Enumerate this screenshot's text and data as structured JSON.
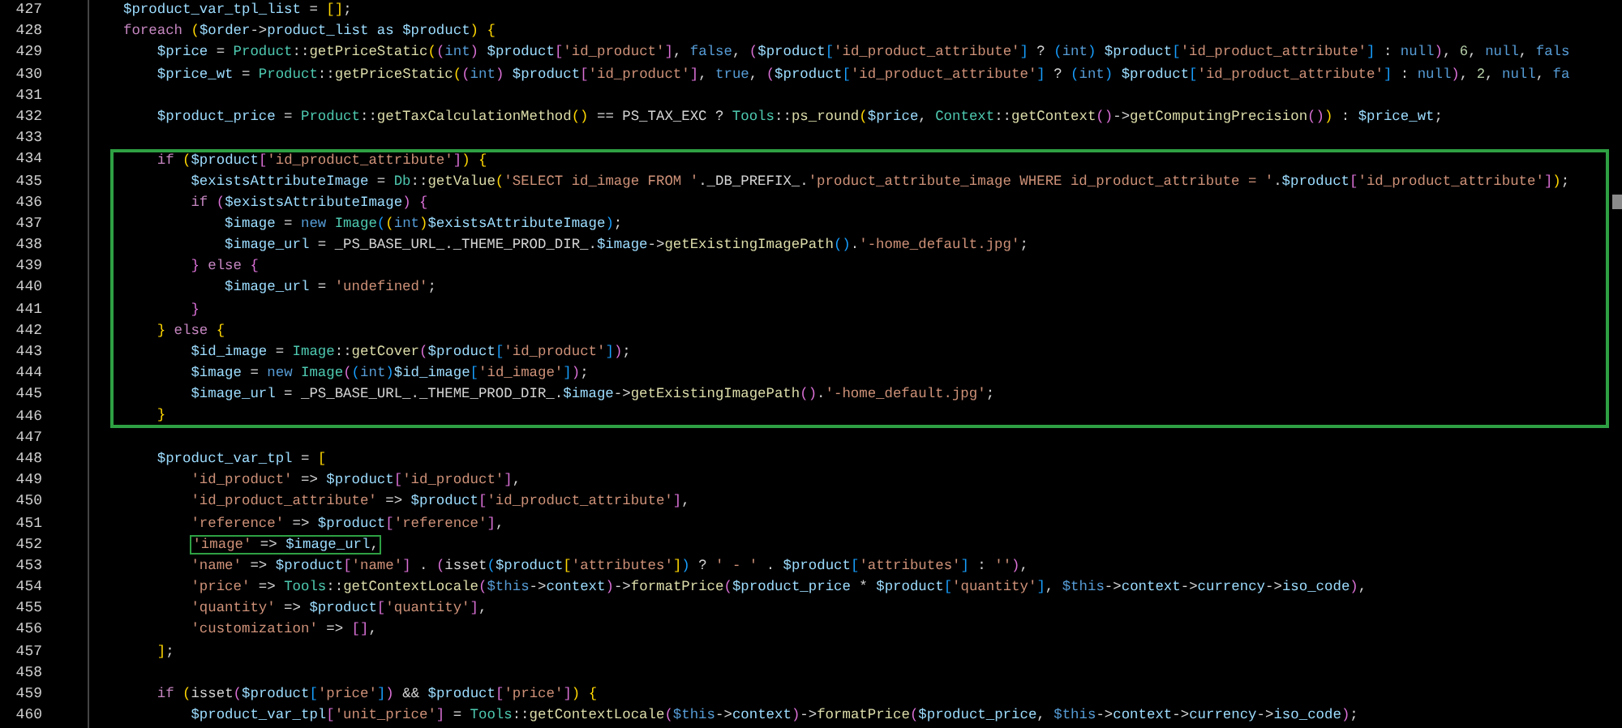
{
  "lines": [
    {
      "number": "427",
      "outlined": false,
      "tokens": [
        {
          "text": "$product_var_tpl_list",
          "kind": "var"
        },
        {
          "text": " = ",
          "kind": "op"
        },
        {
          "text": "[]",
          "kind": "b1"
        },
        {
          "text": ";",
          "kind": "op"
        }
      ]
    },
    {
      "number": "428",
      "outlined": false,
      "tokens": [
        {
          "text": "foreach ",
          "kind": "kw"
        },
        {
          "text": "(",
          "kind": "b1"
        },
        {
          "text": "$order",
          "kind": "var"
        },
        {
          "text": "->",
          "kind": "op"
        },
        {
          "text": "product_list as ",
          "kind": "var"
        },
        {
          "text": "$product",
          "kind": "var"
        },
        {
          "text": ")",
          "kind": "b1"
        },
        {
          "text": " {",
          "kind": "b1"
        }
      ]
    },
    {
      "number": "429",
      "outlined": false,
      "tokens": [
        {
          "text": "    $price",
          "kind": "var"
        },
        {
          "text": " = ",
          "kind": "op"
        },
        {
          "text": "Product",
          "kind": "cls"
        },
        {
          "text": "::",
          "kind": "op"
        },
        {
          "text": "getPriceStatic",
          "kind": "fn"
        },
        {
          "text": "(",
          "kind": "b1"
        },
        {
          "text": "(",
          "kind": "b2"
        },
        {
          "text": "int",
          "kind": "key"
        },
        {
          "text": ")",
          "kind": "b2"
        },
        {
          "text": " $product",
          "kind": "var"
        },
        {
          "text": "[",
          "kind": "b2"
        },
        {
          "text": "'id_product'",
          "kind": "str"
        },
        {
          "text": "]",
          "kind": "b2"
        },
        {
          "text": ", ",
          "kind": "op"
        },
        {
          "text": "false",
          "kind": "key"
        },
        {
          "text": ", ",
          "kind": "op"
        },
        {
          "text": "(",
          "kind": "b2"
        },
        {
          "text": "$product",
          "kind": "var"
        },
        {
          "text": "[",
          "kind": "b3"
        },
        {
          "text": "'id_product_attribute'",
          "kind": "str"
        },
        {
          "text": "]",
          "kind": "b3"
        },
        {
          "text": " ? ",
          "kind": "op"
        },
        {
          "text": "(",
          "kind": "b3"
        },
        {
          "text": "int",
          "kind": "key"
        },
        {
          "text": ")",
          "kind": "b3"
        },
        {
          "text": " $product",
          "kind": "var"
        },
        {
          "text": "[",
          "kind": "b3"
        },
        {
          "text": "'id_product_attribute'",
          "kind": "str"
        },
        {
          "text": "]",
          "kind": "b3"
        },
        {
          "text": " : ",
          "kind": "op"
        },
        {
          "text": "null",
          "kind": "key"
        },
        {
          "text": ")",
          "kind": "b2"
        },
        {
          "text": ", ",
          "kind": "op"
        },
        {
          "text": "6",
          "kind": "num"
        },
        {
          "text": ", ",
          "kind": "op"
        },
        {
          "text": "null",
          "kind": "key"
        },
        {
          "text": ", ",
          "kind": "op"
        },
        {
          "text": "fals",
          "kind": "key"
        }
      ]
    },
    {
      "number": "430",
      "outlined": false,
      "tokens": [
        {
          "text": "    $price_wt",
          "kind": "var"
        },
        {
          "text": " = ",
          "kind": "op"
        },
        {
          "text": "Product",
          "kind": "cls"
        },
        {
          "text": "::",
          "kind": "op"
        },
        {
          "text": "getPriceStatic",
          "kind": "fn"
        },
        {
          "text": "(",
          "kind": "b1"
        },
        {
          "text": "(",
          "kind": "b2"
        },
        {
          "text": "int",
          "kind": "key"
        },
        {
          "text": ")",
          "kind": "b2"
        },
        {
          "text": " $product",
          "kind": "var"
        },
        {
          "text": "[",
          "kind": "b2"
        },
        {
          "text": "'id_product'",
          "kind": "str"
        },
        {
          "text": "]",
          "kind": "b2"
        },
        {
          "text": ", ",
          "kind": "op"
        },
        {
          "text": "true",
          "kind": "key"
        },
        {
          "text": ", ",
          "kind": "op"
        },
        {
          "text": "(",
          "kind": "b2"
        },
        {
          "text": "$product",
          "kind": "var"
        },
        {
          "text": "[",
          "kind": "b3"
        },
        {
          "text": "'id_product_attribute'",
          "kind": "str"
        },
        {
          "text": "]",
          "kind": "b3"
        },
        {
          "text": " ? ",
          "kind": "op"
        },
        {
          "text": "(",
          "kind": "b3"
        },
        {
          "text": "int",
          "kind": "key"
        },
        {
          "text": ")",
          "kind": "b3"
        },
        {
          "text": " $product",
          "kind": "var"
        },
        {
          "text": "[",
          "kind": "b3"
        },
        {
          "text": "'id_product_attribute'",
          "kind": "str"
        },
        {
          "text": "]",
          "kind": "b3"
        },
        {
          "text": " : ",
          "kind": "op"
        },
        {
          "text": "null",
          "kind": "key"
        },
        {
          "text": ")",
          "kind": "b2"
        },
        {
          "text": ", ",
          "kind": "op"
        },
        {
          "text": "2",
          "kind": "num"
        },
        {
          "text": ", ",
          "kind": "op"
        },
        {
          "text": "null",
          "kind": "key"
        },
        {
          "text": ", ",
          "kind": "op"
        },
        {
          "text": "fa",
          "kind": "key"
        }
      ]
    },
    {
      "number": "431",
      "outlined": false
    },
    {
      "number": "432",
      "outlined": false,
      "tokens": [
        {
          "text": "    $product_price",
          "kind": "var"
        },
        {
          "text": " = ",
          "kind": "op"
        },
        {
          "text": "Product",
          "kind": "cls"
        },
        {
          "text": "::",
          "kind": "op"
        },
        {
          "text": "getTaxCalculationMethod",
          "kind": "fn"
        },
        {
          "text": "()",
          "kind": "b1"
        },
        {
          "text": " == PS_TAX_EXC ? ",
          "kind": "op"
        },
        {
          "text": "Tools",
          "kind": "cls"
        },
        {
          "text": "::",
          "kind": "op"
        },
        {
          "text": "ps_round",
          "kind": "fn"
        },
        {
          "text": "(",
          "kind": "b1"
        },
        {
          "text": "$price",
          "kind": "var"
        },
        {
          "text": ", ",
          "kind": "op"
        },
        {
          "text": "Context",
          "kind": "cls"
        },
        {
          "text": "::",
          "kind": "op"
        },
        {
          "text": "getContext",
          "kind": "fn"
        },
        {
          "text": "()",
          "kind": "b2"
        },
        {
          "text": "->",
          "kind": "op"
        },
        {
          "text": "getComputingPrecision",
          "kind": "fn"
        },
        {
          "text": "()",
          "kind": "b2"
        },
        {
          "text": ")",
          "kind": "b1"
        },
        {
          "text": " : ",
          "kind": "op"
        },
        {
          "text": "$price_wt",
          "kind": "var"
        },
        {
          "text": ";",
          "kind": "op"
        }
      ]
    },
    {
      "number": "433",
      "outlined": false
    },
    {
      "number": "434",
      "outlined": true,
      "tokens": [
        {
          "text": "    if ",
          "kind": "kw"
        },
        {
          "text": "(",
          "kind": "b1"
        },
        {
          "text": "$product",
          "kind": "var"
        },
        {
          "text": "[",
          "kind": "b2"
        },
        {
          "text": "'id_product_attribute'",
          "kind": "str"
        },
        {
          "text": "]",
          "kind": "b2"
        },
        {
          "text": ")",
          "kind": "b1"
        },
        {
          "text": " {",
          "kind": "b1"
        }
      ]
    },
    {
      "number": "435",
      "outlined": true,
      "tokens": [
        {
          "text": "        $existsAttributeImage",
          "kind": "var"
        },
        {
          "text": " = ",
          "kind": "op"
        },
        {
          "text": "Db",
          "kind": "cls"
        },
        {
          "text": "::",
          "kind": "op"
        },
        {
          "text": "getValue",
          "kind": "fn"
        },
        {
          "text": "(",
          "kind": "b1"
        },
        {
          "text": "'SELECT id_image FROM '",
          "kind": "str"
        },
        {
          "text": "._DB_PREFIX_.",
          "kind": "op"
        },
        {
          "text": "'product_attribute_image WHERE id_product_attribute = '",
          "kind": "str"
        },
        {
          "text": ".",
          "kind": "op"
        },
        {
          "text": "$product",
          "kind": "var"
        },
        {
          "text": "[",
          "kind": "b2"
        },
        {
          "text": "'id_product_attribute'",
          "kind": "str"
        },
        {
          "text": "]",
          "kind": "b2"
        },
        {
          "text": ")",
          "kind": "b1"
        },
        {
          "text": ";",
          "kind": "op"
        }
      ]
    },
    {
      "number": "436",
      "outlined": true,
      "tokens": [
        {
          "text": "        if ",
          "kind": "kw"
        },
        {
          "text": "(",
          "kind": "b2"
        },
        {
          "text": "$existsAttributeImage",
          "kind": "var"
        },
        {
          "text": ")",
          "kind": "b2"
        },
        {
          "text": " {",
          "kind": "b2"
        }
      ]
    },
    {
      "number": "437",
      "outlined": true,
      "tokens": [
        {
          "text": "            $image",
          "kind": "var"
        },
        {
          "text": " = ",
          "kind": "op"
        },
        {
          "text": "new ",
          "kind": "key"
        },
        {
          "text": "Image",
          "kind": "cls"
        },
        {
          "text": "(",
          "kind": "b3"
        },
        {
          "text": "(",
          "kind": "b1"
        },
        {
          "text": "int",
          "kind": "key"
        },
        {
          "text": ")",
          "kind": "b1"
        },
        {
          "text": "$existsAttributeImage",
          "kind": "var"
        },
        {
          "text": ")",
          "kind": "b3"
        },
        {
          "text": ";",
          "kind": "op"
        }
      ]
    },
    {
      "number": "438",
      "outlined": true,
      "tokens": [
        {
          "text": "            $image_url",
          "kind": "var"
        },
        {
          "text": " = _PS_BASE_URL_._THEME_PROD_DIR_.",
          "kind": "op"
        },
        {
          "text": "$image",
          "kind": "var"
        },
        {
          "text": "->",
          "kind": "op"
        },
        {
          "text": "getExistingImagePath",
          "kind": "fn"
        },
        {
          "text": "()",
          "kind": "b3"
        },
        {
          "text": ".",
          "kind": "op"
        },
        {
          "text": "'-home_default.jpg'",
          "kind": "str"
        },
        {
          "text": ";",
          "kind": "op"
        }
      ]
    },
    {
      "number": "439",
      "outlined": true,
      "tokens": [
        {
          "text": "        }",
          "kind": "b2"
        },
        {
          "text": " else",
          "kind": "kw"
        },
        {
          "text": " {",
          "kind": "b2"
        }
      ]
    },
    {
      "number": "440",
      "outlined": true,
      "tokens": [
        {
          "text": "            $image_url",
          "kind": "var"
        },
        {
          "text": " = ",
          "kind": "op"
        },
        {
          "text": "'undefined'",
          "kind": "str"
        },
        {
          "text": ";",
          "kind": "op"
        }
      ]
    },
    {
      "number": "441",
      "outlined": true,
      "tokens": [
        {
          "text": "        }",
          "kind": "b2"
        }
      ]
    },
    {
      "number": "442",
      "outlined": true,
      "tokens": [
        {
          "text": "    }",
          "kind": "b1"
        },
        {
          "text": " else",
          "kind": "kw"
        },
        {
          "text": " {",
          "kind": "b1"
        }
      ]
    },
    {
      "number": "443",
      "outlined": true,
      "tokens": [
        {
          "text": "        $id_image",
          "kind": "var"
        },
        {
          "text": " = ",
          "kind": "op"
        },
        {
          "text": "Image",
          "kind": "cls"
        },
        {
          "text": "::",
          "kind": "op"
        },
        {
          "text": "getCover",
          "kind": "fn"
        },
        {
          "text": "(",
          "kind": "b2"
        },
        {
          "text": "$product",
          "kind": "var"
        },
        {
          "text": "[",
          "kind": "b3"
        },
        {
          "text": "'id_product'",
          "kind": "str"
        },
        {
          "text": "]",
          "kind": "b3"
        },
        {
          "text": ")",
          "kind": "b2"
        },
        {
          "text": ";",
          "kind": "op"
        }
      ]
    },
    {
      "number": "444",
      "outlined": true,
      "tokens": [
        {
          "text": "        $image",
          "kind": "var"
        },
        {
          "text": " = ",
          "kind": "op"
        },
        {
          "text": "new ",
          "kind": "key"
        },
        {
          "text": "Image",
          "kind": "cls"
        },
        {
          "text": "(",
          "kind": "b2"
        },
        {
          "text": "(",
          "kind": "b3"
        },
        {
          "text": "int",
          "kind": "key"
        },
        {
          "text": ")",
          "kind": "b3"
        },
        {
          "text": "$id_image",
          "kind": "var"
        },
        {
          "text": "[",
          "kind": "b3"
        },
        {
          "text": "'id_image'",
          "kind": "str"
        },
        {
          "text": "]",
          "kind": "b3"
        },
        {
          "text": ")",
          "kind": "b2"
        },
        {
          "text": ";",
          "kind": "op"
        }
      ]
    },
    {
      "number": "445",
      "outlined": true,
      "tokens": [
        {
          "text": "        $image_url",
          "kind": "var"
        },
        {
          "text": " = _PS_BASE_URL_._THEME_PROD_DIR_.",
          "kind": "op"
        },
        {
          "text": "$image",
          "kind": "var"
        },
        {
          "text": "->",
          "kind": "op"
        },
        {
          "text": "getExistingImagePath",
          "kind": "fn"
        },
        {
          "text": "()",
          "kind": "b2"
        },
        {
          "text": ".",
          "kind": "op"
        },
        {
          "text": "'-home_default.jpg'",
          "kind": "str"
        },
        {
          "text": ";",
          "kind": "op"
        }
      ]
    },
    {
      "number": "446",
      "outlined": true,
      "tokens": [
        {
          "text": "    }",
          "kind": "b1"
        }
      ]
    },
    {
      "number": "447",
      "outlined": false
    },
    {
      "number": "448",
      "outlined": false,
      "tokens": [
        {
          "text": "    $product_var_tpl",
          "kind": "var"
        },
        {
          "text": " = ",
          "kind": "op"
        },
        {
          "text": "[",
          "kind": "b1"
        }
      ]
    },
    {
      "number": "449",
      "outlined": false,
      "tokens": [
        {
          "text": "        'id_product'",
          "kind": "str"
        },
        {
          "text": " => ",
          "kind": "op"
        },
        {
          "text": "$product",
          "kind": "var"
        },
        {
          "text": "[",
          "kind": "b2"
        },
        {
          "text": "'id_product'",
          "kind": "str"
        },
        {
          "text": "]",
          "kind": "b2"
        },
        {
          "text": ",",
          "kind": "op"
        }
      ]
    },
    {
      "number": "450",
      "outlined": false,
      "tokens": [
        {
          "text": "        'id_product_attribute'",
          "kind": "str"
        },
        {
          "text": " => ",
          "kind": "op"
        },
        {
          "text": "$product",
          "kind": "var"
        },
        {
          "text": "[",
          "kind": "b2"
        },
        {
          "text": "'id_product_attribute'",
          "kind": "str"
        },
        {
          "text": "]",
          "kind": "b2"
        },
        {
          "text": ",",
          "kind": "op"
        }
      ]
    },
    {
      "number": "451",
      "outlined": false,
      "tokens": [
        {
          "text": "        'reference'",
          "kind": "str"
        },
        {
          "text": " => ",
          "kind": "op"
        },
        {
          "text": "$product",
          "kind": "var"
        },
        {
          "text": "[",
          "kind": "b2"
        },
        {
          "text": "'reference'",
          "kind": "str"
        },
        {
          "text": "]",
          "kind": "b2"
        },
        {
          "text": ",",
          "kind": "op"
        }
      ]
    },
    {
      "number": "452",
      "outlined": true,
      "tokens": [
        {
          "text": "        'image'",
          "kind": "str"
        },
        {
          "text": " => ",
          "kind": "op"
        },
        {
          "text": "$image_url",
          "kind": "var"
        },
        {
          "text": ",",
          "kind": "op"
        }
      ]
    },
    {
      "number": "453",
      "outlined": false,
      "tokens": [
        {
          "text": "        'name'",
          "kind": "str"
        },
        {
          "text": " => ",
          "kind": "op"
        },
        {
          "text": "$product",
          "kind": "var"
        },
        {
          "text": "[",
          "kind": "b2"
        },
        {
          "text": "'name'",
          "kind": "str"
        },
        {
          "text": "]",
          "kind": "b2"
        },
        {
          "text": " . ",
          "kind": "op"
        },
        {
          "text": "(",
          "kind": "b2"
        },
        {
          "text": "isset",
          "kind": "op"
        },
        {
          "text": "(",
          "kind": "b3"
        },
        {
          "text": "$product",
          "kind": "var"
        },
        {
          "text": "[",
          "kind": "b1"
        },
        {
          "text": "'attributes'",
          "kind": "str"
        },
        {
          "text": "]",
          "kind": "b1"
        },
        {
          "text": ")",
          "kind": "b3"
        },
        {
          "text": " ? ",
          "kind": "op"
        },
        {
          "text": "' - '",
          "kind": "str"
        },
        {
          "text": " . ",
          "kind": "op"
        },
        {
          "text": "$product",
          "kind": "var"
        },
        {
          "text": "[",
          "kind": "b3"
        },
        {
          "text": "'attributes'",
          "kind": "str"
        },
        {
          "text": "]",
          "kind": "b3"
        },
        {
          "text": " : ",
          "kind": "op"
        },
        {
          "text": "''",
          "kind": "str"
        },
        {
          "text": ")",
          "kind": "b2"
        },
        {
          "text": ",",
          "kind": "op"
        }
      ]
    },
    {
      "number": "454",
      "outlined": false,
      "tokens": [
        {
          "text": "        'price'",
          "kind": "str"
        },
        {
          "text": " => ",
          "kind": "op"
        },
        {
          "text": "Tools",
          "kind": "cls"
        },
        {
          "text": "::",
          "kind": "op"
        },
        {
          "text": "getContextLocale",
          "kind": "fn"
        },
        {
          "text": "(",
          "kind": "b2"
        },
        {
          "text": "$this",
          "kind": "key"
        },
        {
          "text": "->",
          "kind": "op"
        },
        {
          "text": "context",
          "kind": "var"
        },
        {
          "text": ")",
          "kind": "b2"
        },
        {
          "text": "->",
          "kind": "op"
        },
        {
          "text": "formatPrice",
          "kind": "fn"
        },
        {
          "text": "(",
          "kind": "b2"
        },
        {
          "text": "$product_price",
          "kind": "var"
        },
        {
          "text": " * ",
          "kind": "op"
        },
        {
          "text": "$product",
          "kind": "var"
        },
        {
          "text": "[",
          "kind": "b3"
        },
        {
          "text": "'quantity'",
          "kind": "str"
        },
        {
          "text": "]",
          "kind": "b3"
        },
        {
          "text": ", ",
          "kind": "op"
        },
        {
          "text": "$this",
          "kind": "key"
        },
        {
          "text": "->",
          "kind": "op"
        },
        {
          "text": "context",
          "kind": "var"
        },
        {
          "text": "->",
          "kind": "op"
        },
        {
          "text": "currency",
          "kind": "var"
        },
        {
          "text": "->",
          "kind": "op"
        },
        {
          "text": "iso_code",
          "kind": "var"
        },
        {
          "text": ")",
          "kind": "b2"
        },
        {
          "text": ",",
          "kind": "op"
        }
      ]
    },
    {
      "number": "455",
      "outlined": false,
      "tokens": [
        {
          "text": "        'quantity'",
          "kind": "str"
        },
        {
          "text": " => ",
          "kind": "op"
        },
        {
          "text": "$product",
          "kind": "var"
        },
        {
          "text": "[",
          "kind": "b2"
        },
        {
          "text": "'quantity'",
          "kind": "str"
        },
        {
          "text": "]",
          "kind": "b2"
        },
        {
          "text": ",",
          "kind": "op"
        }
      ]
    },
    {
      "number": "456",
      "outlined": false,
      "tokens": [
        {
          "text": "        'customization'",
          "kind": "str"
        },
        {
          "text": " => ",
          "kind": "op"
        },
        {
          "text": "[]",
          "kind": "b2"
        },
        {
          "text": ",",
          "kind": "op"
        }
      ]
    },
    {
      "number": "457",
      "outlined": false,
      "tokens": [
        {
          "text": "    ]",
          "kind": "b1"
        },
        {
          "text": ";",
          "kind": "op"
        }
      ]
    },
    {
      "number": "458",
      "outlined": false
    },
    {
      "number": "459",
      "outlined": false,
      "tokens": [
        {
          "text": "    if ",
          "kind": "kw"
        },
        {
          "text": "(",
          "kind": "b1"
        },
        {
          "text": "isset",
          "kind": "op"
        },
        {
          "text": "(",
          "kind": "b2"
        },
        {
          "text": "$product",
          "kind": "var"
        },
        {
          "text": "[",
          "kind": "b3"
        },
        {
          "text": "'price'",
          "kind": "str"
        },
        {
          "text": "]",
          "kind": "b3"
        },
        {
          "text": ")",
          "kind": "b2"
        },
        {
          "text": " && ",
          "kind": "op"
        },
        {
          "text": "$product",
          "kind": "var"
        },
        {
          "text": "[",
          "kind": "b2"
        },
        {
          "text": "'price'",
          "kind": "str"
        },
        {
          "text": "]",
          "kind": "b2"
        },
        {
          "text": ")",
          "kind": "b1"
        },
        {
          "text": " {",
          "kind": "b1"
        }
      ]
    },
    {
      "number": "460",
      "outlined": false,
      "tokens": [
        {
          "text": "        $product_var_tpl",
          "kind": "var"
        },
        {
          "text": "[",
          "kind": "b2"
        },
        {
          "text": "'unit_price'",
          "kind": "str"
        },
        {
          "text": "]",
          "kind": "b2"
        },
        {
          "text": " = ",
          "kind": "op"
        },
        {
          "text": "Tools",
          "kind": "cls"
        },
        {
          "text": "::",
          "kind": "op"
        },
        {
          "text": "getContextLocale",
          "kind": "fn"
        },
        {
          "text": "(",
          "kind": "b2"
        },
        {
          "text": "$this",
          "kind": "key"
        },
        {
          "text": "->",
          "kind": "op"
        },
        {
          "text": "context",
          "kind": "var"
        },
        {
          "text": ")",
          "kind": "b2"
        },
        {
          "text": "->",
          "kind": "op"
        },
        {
          "text": "formatPrice",
          "kind": "fn"
        },
        {
          "text": "(",
          "kind": "b2"
        },
        {
          "text": "$product_price",
          "kind": "var"
        },
        {
          "text": ", ",
          "kind": "op"
        },
        {
          "text": "$this",
          "kind": "key"
        },
        {
          "text": "->",
          "kind": "op"
        },
        {
          "text": "context",
          "kind": "var"
        },
        {
          "text": "->",
          "kind": "op"
        },
        {
          "text": "currency",
          "kind": "var"
        },
        {
          "text": "->",
          "kind": "op"
        },
        {
          "text": "iso_code",
          "kind": "var"
        },
        {
          "text": ")",
          "kind": "b2"
        },
        {
          "text": ";",
          "kind": "op"
        }
      ]
    }
  ]
}
